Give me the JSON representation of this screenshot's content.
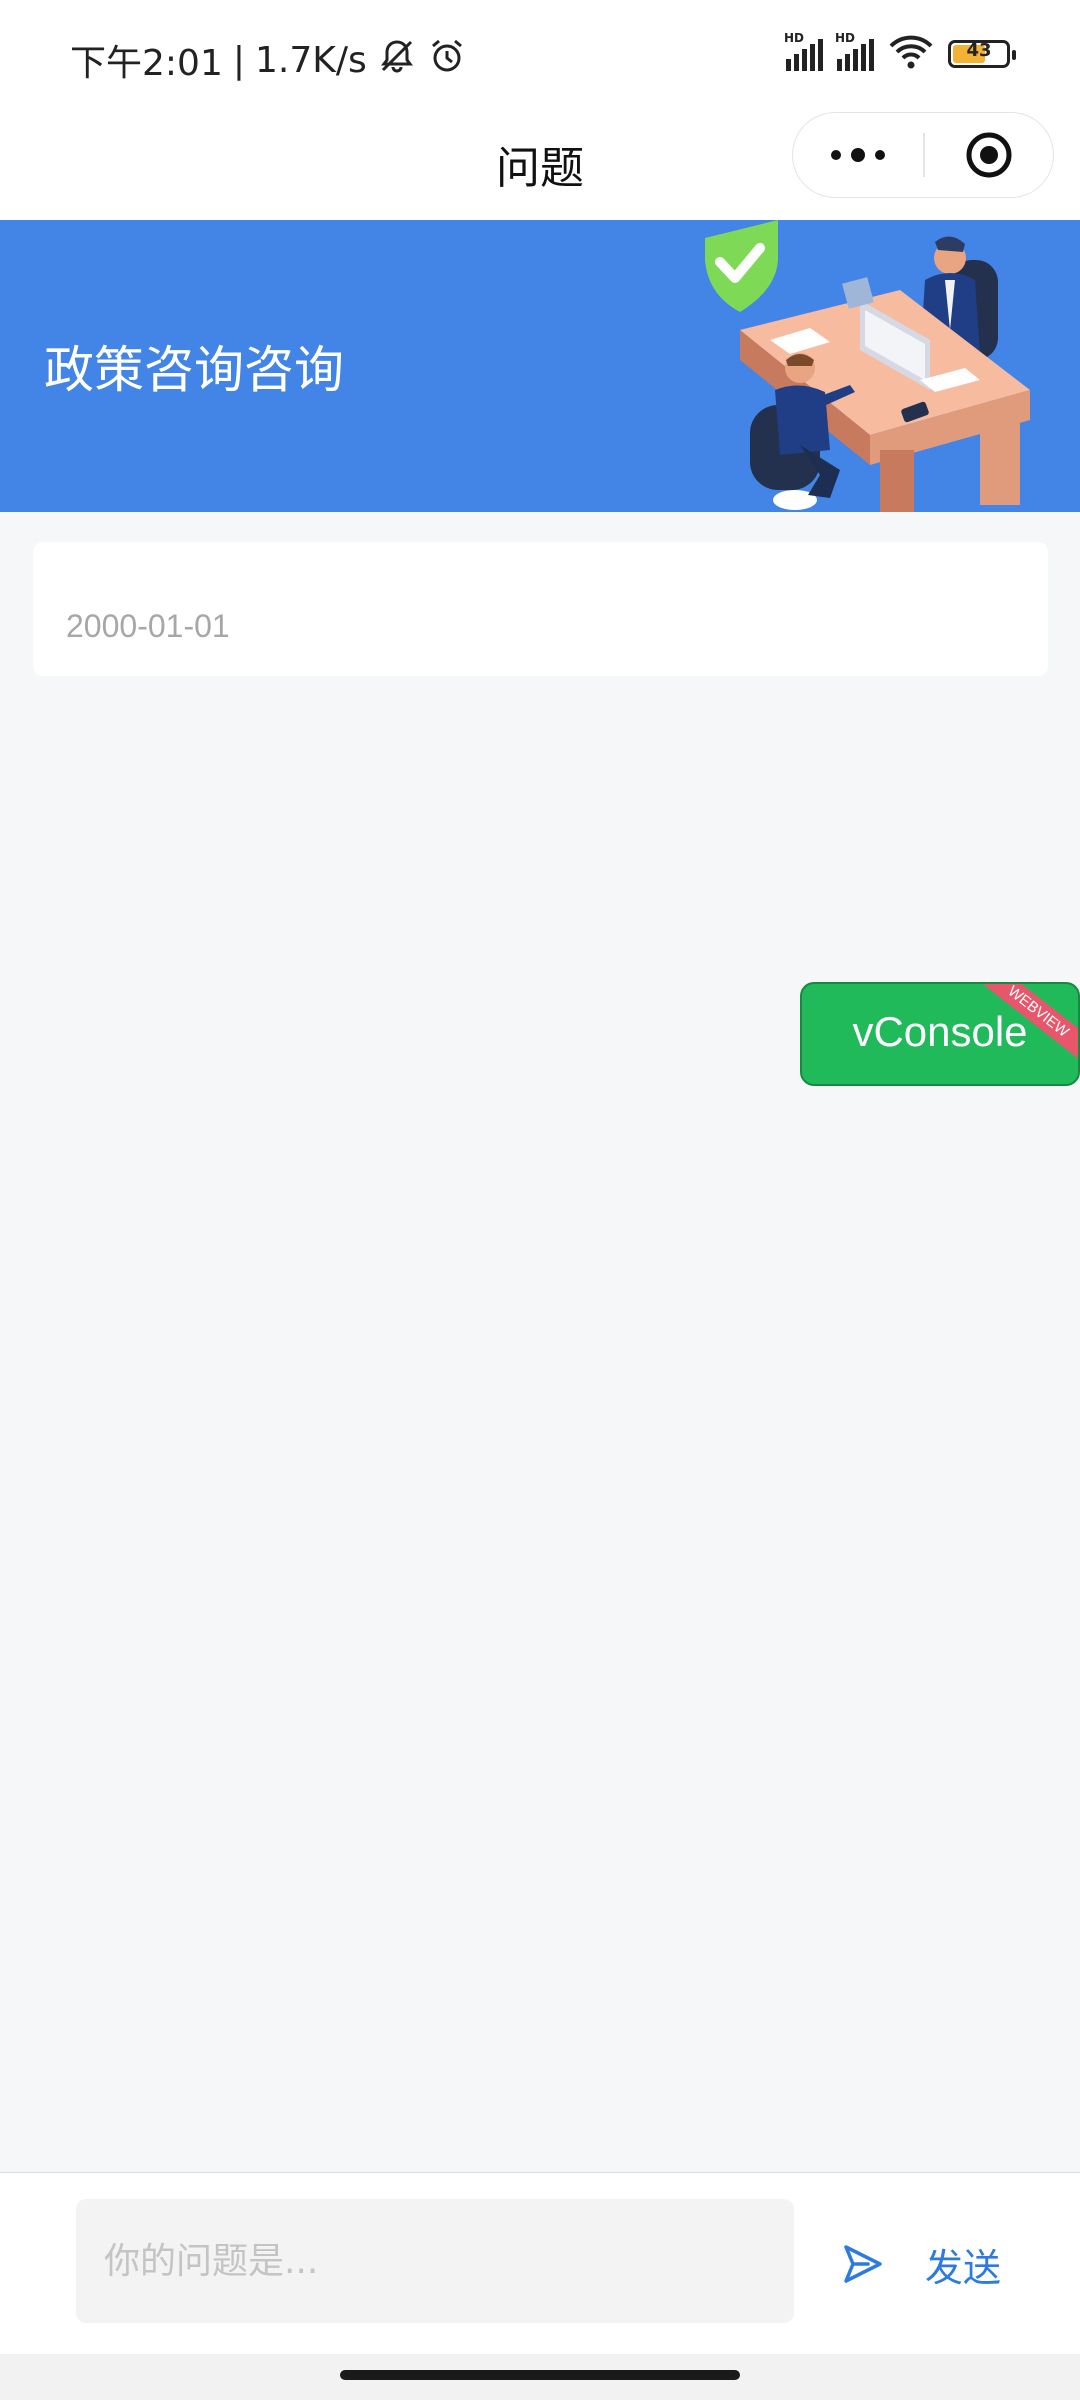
{
  "status_bar": {
    "time": "下午2:01",
    "network_speed": "1.7K/s",
    "battery_level": "43",
    "icons": [
      "bell-off-icon",
      "alarm-icon",
      "hd-signal-icon",
      "hd-signal-icon",
      "wifi-icon",
      "battery-icon"
    ]
  },
  "nav": {
    "title": "问题",
    "capsule_icons": [
      "more-dots-icon",
      "close-target-icon"
    ]
  },
  "banner": {
    "title": "政策咨询咨询",
    "background_color": "#4385e6"
  },
  "card": {
    "date": "2000-01-01"
  },
  "vconsole": {
    "label": "vConsole",
    "ribbon": "WEBVIEW",
    "color": "#21ba5a"
  },
  "input_bar": {
    "placeholder": "你的问题是...",
    "send_label": "发送",
    "accent_color": "#2d7be0"
  }
}
